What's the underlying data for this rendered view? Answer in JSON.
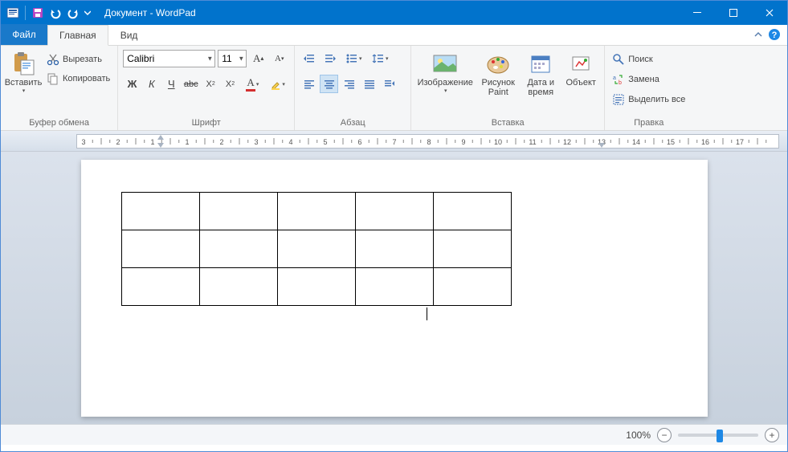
{
  "titlebar": {
    "title": "Документ - WordPad"
  },
  "tabs": {
    "file": "Файл",
    "home": "Главная",
    "view": "Вид"
  },
  "clipboard": {
    "paste": "Вставить",
    "cut": "Вырезать",
    "copy": "Копировать",
    "group_label": "Буфер обмена"
  },
  "font": {
    "name": "Calibri",
    "size": "11",
    "group_label": "Шрифт",
    "bold": "Ж",
    "italic": "К",
    "underline": "Ч",
    "strike": "abc",
    "sub": "X₂",
    "sup": "X²"
  },
  "paragraph": {
    "group_label": "Абзац"
  },
  "insert": {
    "image": "Изображение",
    "paint": "Рисунок Paint",
    "datetime": "Дата и время",
    "object": "Объект",
    "group_label": "Вставка"
  },
  "editing": {
    "find": "Поиск",
    "replace": "Замена",
    "selectall": "Выделить все",
    "group_label": "Правка"
  },
  "ruler": {
    "numbers": [
      "3",
      "2",
      "1",
      "1",
      "2",
      "3",
      "4",
      "5",
      "6",
      "7",
      "8",
      "9",
      "10",
      "11",
      "12",
      "13",
      "14",
      "15",
      "16",
      "17"
    ]
  },
  "document": {
    "table": {
      "rows": 3,
      "cols": 5
    }
  },
  "statusbar": {
    "zoom": "100%"
  }
}
